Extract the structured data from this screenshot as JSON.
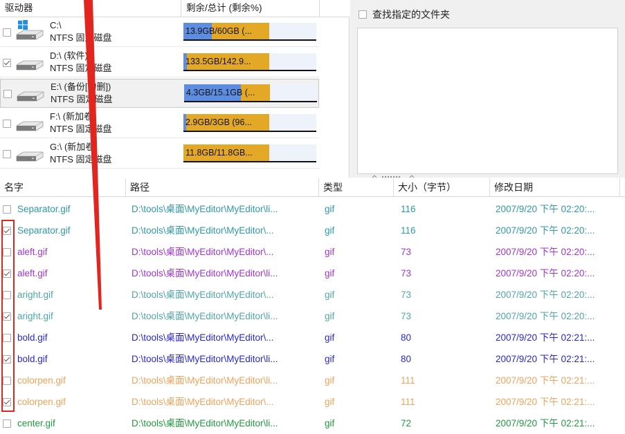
{
  "drives_header": {
    "col_drive": "驱动器",
    "col_space": "剩余/总计 (剩余%)"
  },
  "drives": [
    {
      "name": "C:\\",
      "fs": "NTFS 固定磁盘",
      "space": "13.9GB/60GB (...",
      "free_fraction": 0.23,
      "checked": false,
      "selected": false,
      "windows": true
    },
    {
      "name": "D:\\ (软件)",
      "fs": "NTFS 固定磁盘",
      "space": "133.5GB/142.9...",
      "free_fraction": 0.03,
      "checked": true,
      "selected": false,
      "windows": false
    },
    {
      "name": "E:\\ (备份[勿删])",
      "fs": "NTFS 固定磁盘",
      "space": "4.3GB/15.1GB (...",
      "free_fraction": 0.46,
      "checked": false,
      "selected": true,
      "windows": false
    },
    {
      "name": "F:\\ (新加卷)",
      "fs": "NTFS 固定磁盘",
      "space": "2.9GB/3GB (96...",
      "free_fraction": 0.02,
      "checked": false,
      "selected": false,
      "windows": false
    },
    {
      "name": "G:\\ (新加卷)",
      "fs": "NTFS 固定磁盘",
      "space": "11.8GB/11.8GB...",
      "free_fraction": 0.0,
      "checked": false,
      "selected": false,
      "windows": false
    }
  ],
  "find_folder": {
    "label": "查找指定的文件夹",
    "checked": false
  },
  "files_header": {
    "name": "名字",
    "path": "路径",
    "type": "类型",
    "size": "大小（字节）",
    "date": "修改日期"
  },
  "files": [
    {
      "checked": false,
      "name": "Separator.gif",
      "path": "D:\\tools\\桌面\\MyEditor\\MyEditor\\li...",
      "type": "gif",
      "size": "116",
      "date": "2007/9/20 下午 02:20:...",
      "color": "#2e9aa4"
    },
    {
      "checked": true,
      "name": "Separator.gif",
      "path": "D:\\tools\\桌面\\MyEditor\\MyEditor\\...",
      "type": "gif",
      "size": "116",
      "date": "2007/9/20 下午 02:20:...",
      "color": "#2e9aa4"
    },
    {
      "checked": false,
      "name": "aleft.gif",
      "path": "D:\\tools\\桌面\\MyEditor\\MyEditor\\...",
      "type": "gif",
      "size": "73",
      "date": "2007/9/20 下午 02:20:...",
      "color": "#a233d4"
    },
    {
      "checked": true,
      "name": "aleft.gif",
      "path": "D:\\tools\\桌面\\MyEditor\\MyEditor\\li...",
      "type": "gif",
      "size": "73",
      "date": "2007/9/20 下午 02:20:...",
      "color": "#a233d4"
    },
    {
      "checked": false,
      "name": "aright.gif",
      "path": "D:\\tools\\桌面\\MyEditor\\MyEditor\\...",
      "type": "gif",
      "size": "73",
      "date": "2007/9/20 下午 02:20:...",
      "color": "#4fa6a6"
    },
    {
      "checked": true,
      "name": "aright.gif",
      "path": "D:\\tools\\桌面\\MyEditor\\MyEditor\\li...",
      "type": "gif",
      "size": "73",
      "date": "2007/9/20 下午 02:20:...",
      "color": "#4fa6a6"
    },
    {
      "checked": false,
      "name": "bold.gif",
      "path": "D:\\tools\\桌面\\MyEditor\\MyEditor\\...",
      "type": "gif",
      "size": "80",
      "date": "2007/9/20 下午 02:21:...",
      "color": "#2626d6"
    },
    {
      "checked": true,
      "name": "bold.gif",
      "path": "D:\\tools\\桌面\\MyEditor\\MyEditor\\li...",
      "type": "gif",
      "size": "80",
      "date": "2007/9/20 下午 02:21:...",
      "color": "#2626d6"
    },
    {
      "checked": false,
      "name": "colorpen.gif",
      "path": "D:\\tools\\桌面\\MyEditor\\MyEditor\\li...",
      "type": "gif",
      "size": "111",
      "date": "2007/9/20 下午 02:21:...",
      "color": "#f0a25a"
    },
    {
      "checked": true,
      "name": "colorpen.gif",
      "path": "D:\\tools\\桌面\\MyEditor\\MyEditor\\...",
      "type": "gif",
      "size": "111",
      "date": "2007/9/20 下午 02:21:...",
      "color": "#f0a25a"
    },
    {
      "checked": false,
      "name": "center.gif",
      "path": "D:\\tools\\桌面\\MyEditor\\MyEditor\\li...",
      "type": "gif",
      "size": "72",
      "date": "2007/9/20 下午 02:21:...",
      "color": "#1f9a3e"
    }
  ],
  "colors": {
    "used_bar": "#e3a826",
    "free_bar": "#5d8de0",
    "annotation": "#e2261f"
  }
}
